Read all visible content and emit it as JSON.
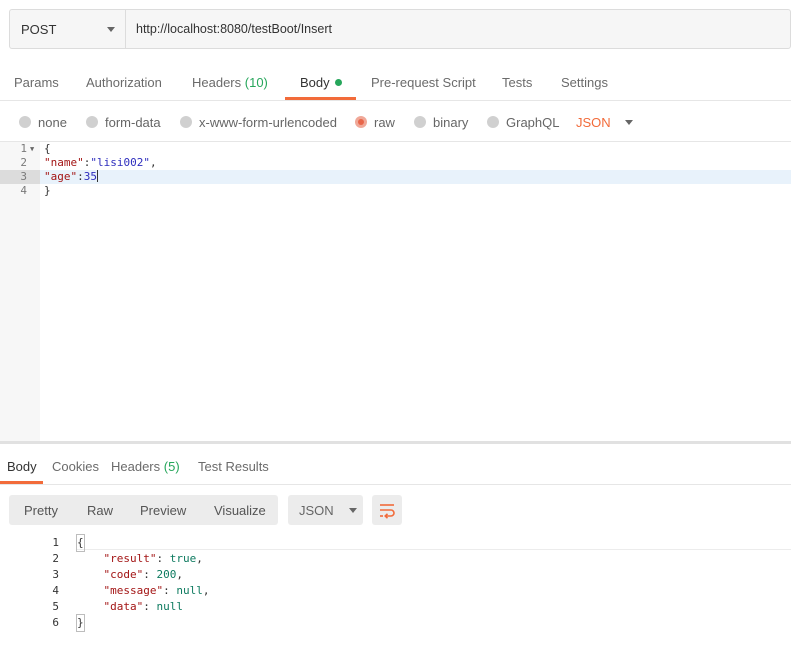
{
  "request": {
    "method": "POST",
    "url": "http://localhost:8080/testBoot/Insert"
  },
  "request_tabs": [
    {
      "label": "Params"
    },
    {
      "label": "Authorization"
    },
    {
      "label": "Headers",
      "count": "(10)"
    },
    {
      "label": "Body",
      "active": true
    },
    {
      "label": "Pre-request Script"
    },
    {
      "label": "Tests"
    },
    {
      "label": "Settings"
    }
  ],
  "body_types": [
    {
      "label": "none"
    },
    {
      "label": "form-data"
    },
    {
      "label": "x-www-form-urlencoded"
    },
    {
      "label": "raw",
      "selected": true
    },
    {
      "label": "binary"
    },
    {
      "label": "GraphQL"
    }
  ],
  "body_language": "JSON",
  "request_body": {
    "line_numbers": [
      "1",
      "2",
      "3",
      "4"
    ],
    "lines": [
      "{",
      "\"name\":\"lisi002\",",
      "\"age\":35",
      "}"
    ],
    "active_line": 3
  },
  "response_tabs": [
    {
      "label": "Body",
      "active": true
    },
    {
      "label": "Cookies"
    },
    {
      "label": "Headers",
      "count": "(5)"
    },
    {
      "label": "Test Results"
    }
  ],
  "view_modes": [
    "Pretty",
    "Raw",
    "Preview",
    "Visualize"
  ],
  "response_format": "JSON",
  "response_body": {
    "line_numbers": [
      "1",
      "2",
      "3",
      "4",
      "5",
      "6"
    ],
    "lines": [
      "{",
      "    \"result\": true,",
      "    \"code\": 200,",
      "    \"message\": null,",
      "    \"data\": null",
      "}"
    ]
  },
  "colors": {
    "accent": "#f26b3a",
    "count": "#26a65b",
    "json_key": "#a31515",
    "json_string": "#2d2dbd"
  },
  "icons": {
    "method_dropdown": "chevron-down-icon",
    "body_indicator": "dot-icon",
    "fold": "triangle-down-icon",
    "wrap": "wrap-lines-icon"
  }
}
